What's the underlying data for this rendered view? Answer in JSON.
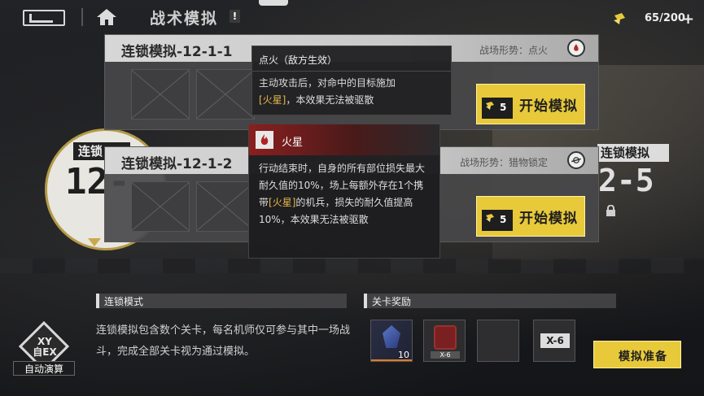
{
  "header": {
    "title": "战术模拟",
    "info_label": "!",
    "stamina": "65/200",
    "stamina_plus": "+"
  },
  "stages": {
    "left_label": "连锁",
    "left_number": "12-",
    "right_label": "连锁模拟",
    "right_number": "2-5"
  },
  "panels": [
    {
      "title": "连锁模拟-12-1-1",
      "status": "战场形势：点火",
      "start_cost": "5",
      "start_label": "开始模拟"
    },
    {
      "title": "连锁模拟-12-1-2",
      "status": "战场形势：猎物锁定",
      "start_cost": "5",
      "start_label": "开始模拟"
    }
  ],
  "tooltip_ignite": {
    "title": "点火（敌方生效）",
    "line1": "主动攻击后，对命中的目标施加",
    "keyword": "[火星]",
    "line2": "，本效果无法被驱散"
  },
  "tooltip_spark": {
    "name": "火星",
    "part1": "行动结束时，自身的所有部位损失最大耐久值的10%，场上每额外存在1个携带",
    "keyword": "[火星]",
    "part2": "的机兵，损失的耐久值提高10%，本效果无法被驱散"
  },
  "chain_mode": {
    "title": "连锁模式",
    "description": "连锁模拟包含数个关卡，每名机师仅可参与其中一场战斗，完成全部关卡视为通过模拟。"
  },
  "rewards": {
    "title": "关卡奖励",
    "crystal_qty": "10",
    "badge_tag": "X-6",
    "item_label": "X-6"
  },
  "auto_battle": {
    "glyph": "XY 自EX",
    "label": "自动演算"
  },
  "prepare_label": "模拟准备"
}
